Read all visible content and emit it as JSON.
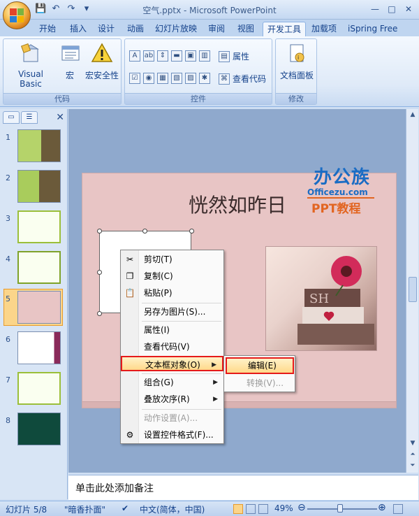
{
  "window": {
    "title": "空气.pptx - Microsoft PowerPoint",
    "minimize": "—",
    "maximize": "□",
    "close": "✕"
  },
  "qat": {
    "save_icon": "save-icon",
    "undo_icon": "undo-icon",
    "redo_icon": "redo-icon",
    "customize_icon": "customize-qat-icon"
  },
  "tabs": [
    {
      "label": "开始"
    },
    {
      "label": "插入"
    },
    {
      "label": "设计"
    },
    {
      "label": "动画"
    },
    {
      "label": "幻灯片放映"
    },
    {
      "label": "审阅"
    },
    {
      "label": "视图"
    },
    {
      "label": "开发工具",
      "active": true
    },
    {
      "label": "加载项"
    },
    {
      "label": "iSpring Free"
    }
  ],
  "ribbon": {
    "code_group": {
      "label": "代码",
      "visual_basic": "Visual Basic",
      "macro": "宏",
      "macro_security": "宏安全性"
    },
    "controls_group": {
      "label": "控件",
      "properties": "属性",
      "view_code": "查看代码"
    },
    "modify_group": {
      "label": "修改",
      "document_panel": "文档面板"
    }
  },
  "slide_panel": {
    "thumbnails": [
      {
        "num": "1"
      },
      {
        "num": "2"
      },
      {
        "num": "3"
      },
      {
        "num": "4"
      },
      {
        "num": "5",
        "selected": true
      },
      {
        "num": "6"
      },
      {
        "num": "7"
      },
      {
        "num": "8"
      }
    ]
  },
  "slide": {
    "title": "恍然如昨日",
    "brand_main": "办公族",
    "brand_url": "Officezu.com",
    "brand_sub": "PPT教程"
  },
  "context_menu": {
    "items": [
      {
        "label": "剪切(T)",
        "icon": "scissors-icon"
      },
      {
        "label": "复制(C)",
        "icon": "copy-icon"
      },
      {
        "label": "粘贴(P)",
        "icon": "paste-icon"
      },
      {
        "label": "另存为图片(S)...",
        "icon": ""
      },
      {
        "label": "属性(I)",
        "icon": ""
      },
      {
        "label": "查看代码(V)",
        "icon": ""
      },
      {
        "label": "文本框对象(O)",
        "icon": "",
        "submenu": true
      },
      {
        "label": "组合(G)",
        "icon": "",
        "submenu": true
      },
      {
        "label": "叠放次序(R)",
        "icon": "",
        "submenu": true
      },
      {
        "label": "动作设置(A)...",
        "icon": "",
        "disabled": true
      },
      {
        "label": "设置控件格式(F)...",
        "icon": "format-control-icon"
      }
    ],
    "submenu": {
      "edit": "编辑(E)",
      "convert": "转换(V)..."
    }
  },
  "notes": {
    "placeholder": "单击此处添加备注"
  },
  "statusbar": {
    "slide_pos": "幻灯片 5/8",
    "theme": "\"暗香扑面\"",
    "language": "中文(简体，中国)",
    "zoom": "49%",
    "zoom_out": "⊖",
    "zoom_in": "⊕"
  },
  "colors": {
    "accent": "#15428b",
    "highlight_border": "#e51a1a",
    "slide_bg": "#e8c5c5"
  }
}
